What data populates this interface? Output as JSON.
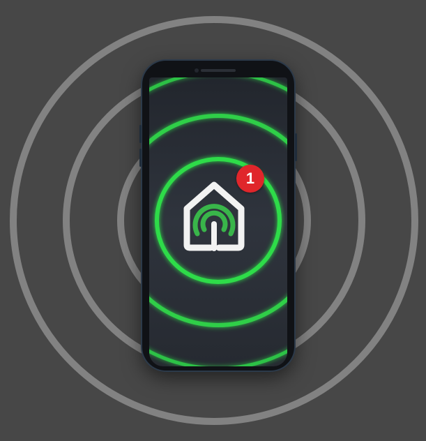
{
  "notification_badge": {
    "count": "1",
    "color": "#e0262b"
  },
  "app_icon": {
    "name": "smart-home-wifi-icon",
    "accent_color": "#39b54a"
  },
  "colors": {
    "background": "#474747",
    "ripple": "#bdbdbd",
    "glow": "#2fdc4a"
  }
}
